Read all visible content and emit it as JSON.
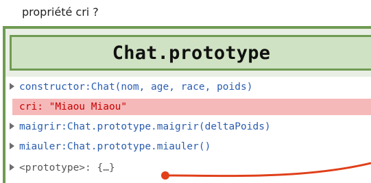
{
  "caption": "propriété cri ?",
  "title": "Chat.prototype",
  "rows": [
    {
      "text": "constructor:Chat(nom, age, race, poids)"
    },
    {
      "key": "cri:",
      "value": "\"Miaou Miaou\""
    },
    {
      "text": "maigrir:Chat.prototype.maigrir(deltaPoids)"
    },
    {
      "text": "miauler:Chat.prototype.miauler()"
    },
    {
      "key": "<prototype>:",
      "value": "{…}"
    }
  ],
  "colors": {
    "frame": "#6f9b52",
    "title_bg": "#cfe2c3",
    "highlight": "#f6b9b9",
    "connector": "#e0401a"
  }
}
